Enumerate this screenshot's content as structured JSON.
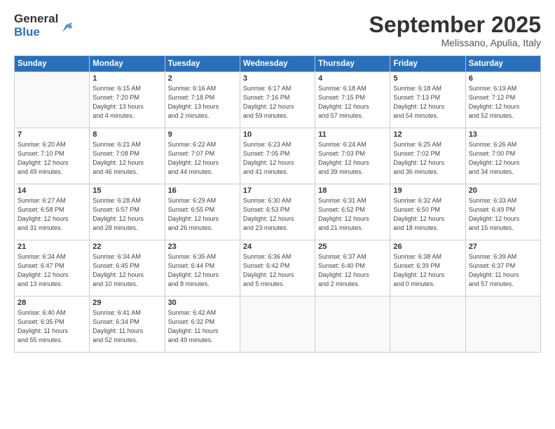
{
  "logo": {
    "general": "General",
    "blue": "Blue"
  },
  "header": {
    "month": "September 2025",
    "location": "Melissano, Apulia, Italy"
  },
  "weekdays": [
    "Sunday",
    "Monday",
    "Tuesday",
    "Wednesday",
    "Thursday",
    "Friday",
    "Saturday"
  ],
  "weeks": [
    [
      {
        "day": "",
        "info": ""
      },
      {
        "day": "1",
        "info": "Sunrise: 6:15 AM\nSunset: 7:20 PM\nDaylight: 13 hours\nand 4 minutes."
      },
      {
        "day": "2",
        "info": "Sunrise: 6:16 AM\nSunset: 7:18 PM\nDaylight: 13 hours\nand 2 minutes."
      },
      {
        "day": "3",
        "info": "Sunrise: 6:17 AM\nSunset: 7:16 PM\nDaylight: 12 hours\nand 59 minutes."
      },
      {
        "day": "4",
        "info": "Sunrise: 6:18 AM\nSunset: 7:15 PM\nDaylight: 12 hours\nand 57 minutes."
      },
      {
        "day": "5",
        "info": "Sunrise: 6:18 AM\nSunset: 7:13 PM\nDaylight: 12 hours\nand 54 minutes."
      },
      {
        "day": "6",
        "info": "Sunrise: 6:19 AM\nSunset: 7:12 PM\nDaylight: 12 hours\nand 52 minutes."
      }
    ],
    [
      {
        "day": "7",
        "info": "Sunrise: 6:20 AM\nSunset: 7:10 PM\nDaylight: 12 hours\nand 49 minutes."
      },
      {
        "day": "8",
        "info": "Sunrise: 6:21 AM\nSunset: 7:08 PM\nDaylight: 12 hours\nand 46 minutes."
      },
      {
        "day": "9",
        "info": "Sunrise: 6:22 AM\nSunset: 7:07 PM\nDaylight: 12 hours\nand 44 minutes."
      },
      {
        "day": "10",
        "info": "Sunrise: 6:23 AM\nSunset: 7:05 PM\nDaylight: 12 hours\nand 41 minutes."
      },
      {
        "day": "11",
        "info": "Sunrise: 6:24 AM\nSunset: 7:03 PM\nDaylight: 12 hours\nand 39 minutes."
      },
      {
        "day": "12",
        "info": "Sunrise: 6:25 AM\nSunset: 7:02 PM\nDaylight: 12 hours\nand 36 minutes."
      },
      {
        "day": "13",
        "info": "Sunrise: 6:26 AM\nSunset: 7:00 PM\nDaylight: 12 hours\nand 34 minutes."
      }
    ],
    [
      {
        "day": "14",
        "info": "Sunrise: 6:27 AM\nSunset: 6:58 PM\nDaylight: 12 hours\nand 31 minutes."
      },
      {
        "day": "15",
        "info": "Sunrise: 6:28 AM\nSunset: 6:57 PM\nDaylight: 12 hours\nand 28 minutes."
      },
      {
        "day": "16",
        "info": "Sunrise: 6:29 AM\nSunset: 6:55 PM\nDaylight: 12 hours\nand 26 minutes."
      },
      {
        "day": "17",
        "info": "Sunrise: 6:30 AM\nSunset: 6:53 PM\nDaylight: 12 hours\nand 23 minutes."
      },
      {
        "day": "18",
        "info": "Sunrise: 6:31 AM\nSunset: 6:52 PM\nDaylight: 12 hours\nand 21 minutes."
      },
      {
        "day": "19",
        "info": "Sunrise: 6:32 AM\nSunset: 6:50 PM\nDaylight: 12 hours\nand 18 minutes."
      },
      {
        "day": "20",
        "info": "Sunrise: 6:33 AM\nSunset: 6:49 PM\nDaylight: 12 hours\nand 15 minutes."
      }
    ],
    [
      {
        "day": "21",
        "info": "Sunrise: 6:34 AM\nSunset: 6:47 PM\nDaylight: 12 hours\nand 13 minutes."
      },
      {
        "day": "22",
        "info": "Sunrise: 6:34 AM\nSunset: 6:45 PM\nDaylight: 12 hours\nand 10 minutes."
      },
      {
        "day": "23",
        "info": "Sunrise: 6:35 AM\nSunset: 6:44 PM\nDaylight: 12 hours\nand 8 minutes."
      },
      {
        "day": "24",
        "info": "Sunrise: 6:36 AM\nSunset: 6:42 PM\nDaylight: 12 hours\nand 5 minutes."
      },
      {
        "day": "25",
        "info": "Sunrise: 6:37 AM\nSunset: 6:40 PM\nDaylight: 12 hours\nand 2 minutes."
      },
      {
        "day": "26",
        "info": "Sunrise: 6:38 AM\nSunset: 6:39 PM\nDaylight: 12 hours\nand 0 minutes."
      },
      {
        "day": "27",
        "info": "Sunrise: 6:39 AM\nSunset: 6:37 PM\nDaylight: 11 hours\nand 57 minutes."
      }
    ],
    [
      {
        "day": "28",
        "info": "Sunrise: 6:40 AM\nSunset: 6:35 PM\nDaylight: 11 hours\nand 55 minutes."
      },
      {
        "day": "29",
        "info": "Sunrise: 6:41 AM\nSunset: 6:34 PM\nDaylight: 11 hours\nand 52 minutes."
      },
      {
        "day": "30",
        "info": "Sunrise: 6:42 AM\nSunset: 6:32 PM\nDaylight: 11 hours\nand 49 minutes."
      },
      {
        "day": "",
        "info": ""
      },
      {
        "day": "",
        "info": ""
      },
      {
        "day": "",
        "info": ""
      },
      {
        "day": "",
        "info": ""
      }
    ]
  ]
}
